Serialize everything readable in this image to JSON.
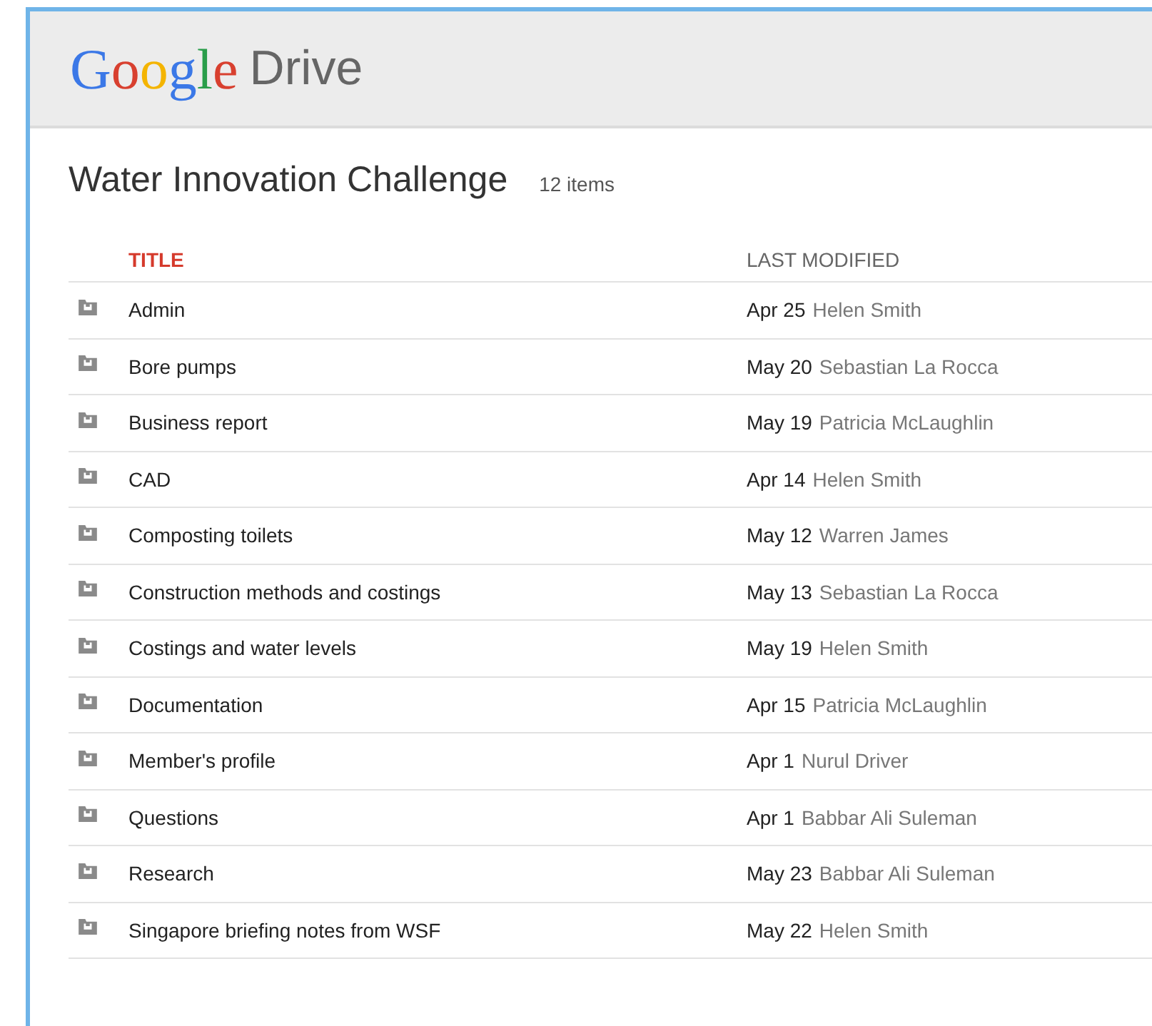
{
  "header": {
    "logo": "Google",
    "product": "Drive"
  },
  "folder": {
    "title": "Water Innovation Challenge",
    "count": "12 items"
  },
  "table": {
    "columns": [
      {
        "label": "TITLE",
        "selected": true
      },
      {
        "label": "LAST MODIFIED",
        "selected": false
      }
    ],
    "rows": [
      {
        "title": "Admin",
        "date": "Apr 25",
        "by": "Helen Smith"
      },
      {
        "title": "Bore pumps",
        "date": "May 20",
        "by": "Sebastian La Rocca"
      },
      {
        "title": "Business report",
        "date": "May 19",
        "by": "Patricia McLaughlin"
      },
      {
        "title": "CAD",
        "date": "Apr 14",
        "by": "Helen Smith"
      },
      {
        "title": "Composting toilets",
        "date": "May 12",
        "by": "Warren James"
      },
      {
        "title": "Construction methods and costings",
        "date": "May 13",
        "by": "Sebastian La Rocca"
      },
      {
        "title": "Costings and water levels",
        "date": "May 19",
        "by": "Helen Smith"
      },
      {
        "title": "Documentation",
        "date": "Apr 15",
        "by": "Patricia McLaughlin"
      },
      {
        "title": "Member's profile",
        "date": "Apr 1",
        "by": "Nurul Driver"
      },
      {
        "title": "Questions",
        "date": "Apr 1",
        "by": "Babbar Ali Suleman"
      },
      {
        "title": "Research",
        "date": "May 23",
        "by": "Babbar Ali Suleman"
      },
      {
        "title": "Singapore briefing notes from WSF",
        "date": "May 22",
        "by": "Helen Smith"
      }
    ]
  }
}
